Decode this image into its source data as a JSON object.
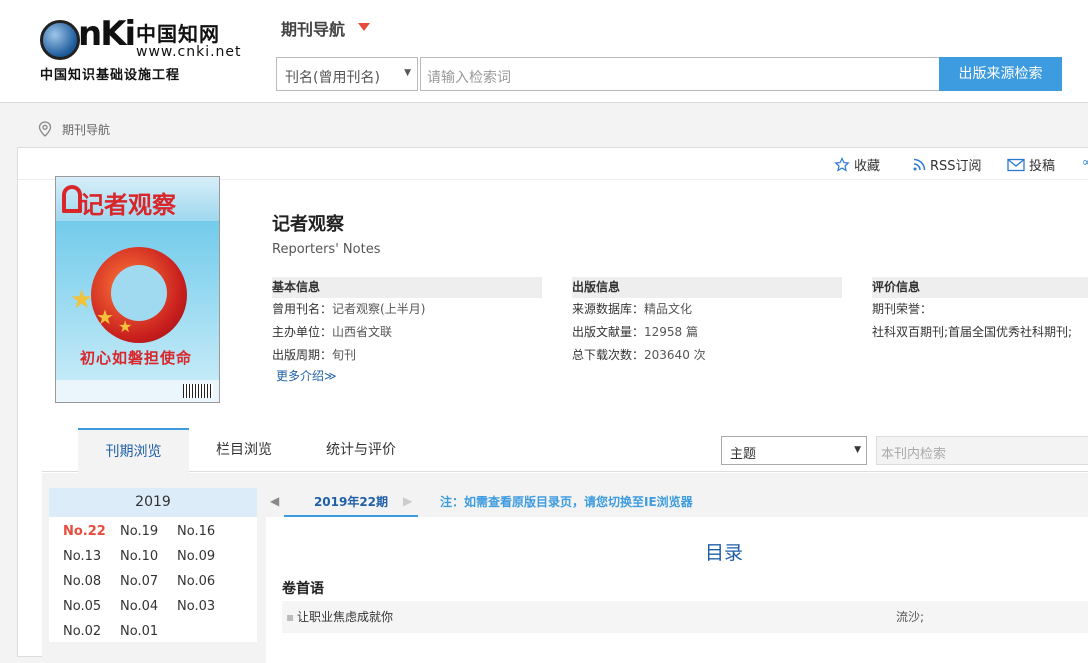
{
  "header": {
    "logo_cn": "中国知网",
    "logo_url": "www.cnki.net",
    "logo_sub": "中国知识基础设施工程",
    "nav_title": "期刊导航",
    "search_type": "刊名(曾用刊名)",
    "search_placeholder": "请输入检索词",
    "search_button": "出版来源检索"
  },
  "breadcrumb": {
    "label": "期刊导航"
  },
  "toolbar": {
    "favorite": "收藏",
    "rss": "RSS订阅",
    "submit": "投稿"
  },
  "journal": {
    "cover_title": "记者观察",
    "cover_slogan": "初心如磐担使命",
    "title": "记者观察",
    "english_title": "Reporters' Notes"
  },
  "basic_info": {
    "heading": "基本信息",
    "rows": [
      {
        "label": "曾用刊名：",
        "value": "记者观察(上半月)"
      },
      {
        "label": "主办单位：",
        "value": "山西省文联"
      },
      {
        "label": "出版周期：",
        "value": "旬刊"
      }
    ],
    "more": "更多介绍≫"
  },
  "publish_info": {
    "heading": "出版信息",
    "rows": [
      {
        "label": "来源数据库：",
        "value": "精品文化"
      },
      {
        "label": "出版文献量：",
        "value": "12958 篇"
      },
      {
        "label": "总下载次数：",
        "value": "203640 次"
      }
    ]
  },
  "eval_info": {
    "heading": "评价信息",
    "honor_label": "期刊荣誉：",
    "honor_value": "社科双百期刊;首届全国优秀社科期刊;"
  },
  "tabs": [
    "刊期浏览",
    "栏目浏览",
    "统计与评价"
  ],
  "topic_select": "主题",
  "inner_search_placeholder": "本刊内检索",
  "year_panel": {
    "year": "2019",
    "issues": [
      "No.22",
      "No.19",
      "No.16",
      "No.13",
      "No.10",
      "No.09",
      "No.08",
      "No.07",
      "No.06",
      "No.05",
      "No.04",
      "No.03",
      "No.02",
      "No.01"
    ],
    "current": "No.22"
  },
  "content": {
    "issue_label": "2019年22期",
    "note": "注：如需查看原版目录页，请您切换至IE浏览器",
    "toc_title": "目录",
    "section": "卷首语",
    "articles": [
      {
        "title": "让职业焦虑成就你",
        "author": "流沙;"
      }
    ]
  }
}
